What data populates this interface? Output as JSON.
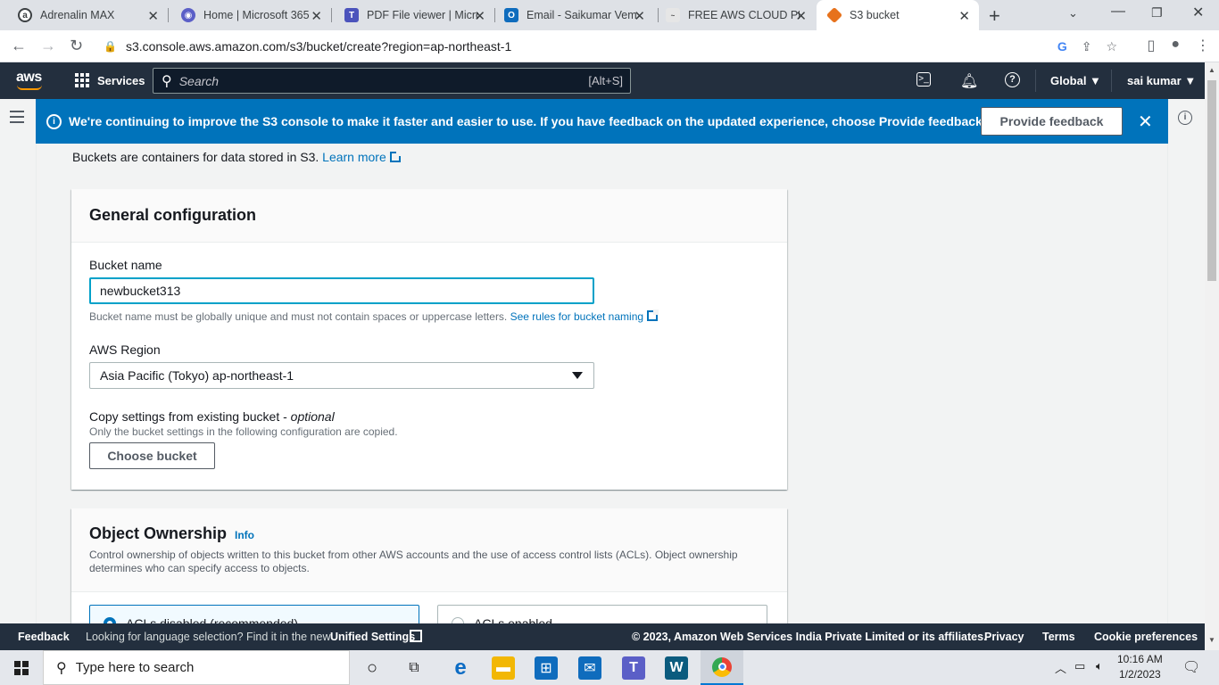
{
  "browser": {
    "tabs": [
      {
        "title": "Adrenalin MAX",
        "favicon_color": "#3c4043",
        "icon": "circle-a-icon"
      },
      {
        "title": "Home | Microsoft 365",
        "favicon_color": "#5b5fc7",
        "icon": "microsoft-365-icon"
      },
      {
        "title": "PDF File viewer | Micro",
        "favicon_color": "#4b53bc",
        "icon": "teams-icon"
      },
      {
        "title": "Email - Saikumar Vem",
        "favicon_color": "#0f6cbd",
        "icon": "outlook-icon"
      },
      {
        "title": "FREE AWS CLOUD PRA",
        "favicon_color": "#888888",
        "icon": "udemy-icon"
      },
      {
        "title": "S3 bucket",
        "favicon_color": "#e7721c",
        "icon": "s3-icon"
      }
    ],
    "url": "s3.console.aws.amazon.com/s3/bucket/create?region=ap-northeast-1"
  },
  "aws_nav": {
    "logo": "aws",
    "services_label": "Services",
    "search_placeholder": "Search",
    "search_shortcut": "[Alt+S]",
    "region": "Global ▼",
    "user": "sai kumar ▼"
  },
  "flash": {
    "message_plain": "We're continuing to improve the S3 console to make it faster and easier to use. If you have feedback on the updated experience, choose ",
    "message_bold": "Provide feedback.",
    "button_label": "Provide feedback",
    "close_glyph": "✕"
  },
  "intro": {
    "text": "Buckets are containers for data stored in S3.",
    "link": "Learn more"
  },
  "general_config": {
    "title": "General configuration",
    "bucket_name_label": "Bucket name",
    "bucket_name_value": "newbucket313",
    "bucket_name_hint": "Bucket name must be globally unique and must not contain spaces or uppercase letters.",
    "bucket_name_link": "See rules for bucket naming",
    "region_label": "AWS Region",
    "region_value": "Asia Pacific (Tokyo) ap-northeast-1",
    "copy_label": "Copy settings from existing bucket - ",
    "copy_label_optional": "optional",
    "copy_hint": "Only the bucket settings in the following configuration are copied.",
    "choose_button": "Choose bucket"
  },
  "object_ownership": {
    "title": "Object Ownership",
    "info": "Info",
    "description": "Control ownership of objects written to this bucket from other AWS accounts and the use of access control lists (ACLs). Object ownership determines who can specify access to objects.",
    "option1": "ACLs disabled (recommended)",
    "option2": "ACLs enabled"
  },
  "footer": {
    "feedback": "Feedback",
    "language_text": "Looking for language selection? Find it in the new",
    "unified_settings": "Unified Settings",
    "copyright": "© 2023, Amazon Web Services India Private Limited or its affiliates.",
    "privacy": "Privacy",
    "terms": "Terms",
    "cookie": "Cookie preferences"
  },
  "taskbar": {
    "search_placeholder": "Type here to search",
    "time": "10:16 AM",
    "date": "1/2/2023"
  }
}
